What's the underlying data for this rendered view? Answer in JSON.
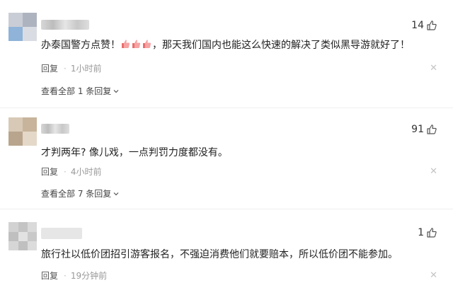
{
  "comments": [
    {
      "like_count": "14",
      "text_before": "办泰国警方点赞！",
      "emoji": [
        "thumbs-up-emoji",
        "thumbs-up-emoji",
        "thumbs-up-emoji"
      ],
      "text_after": "，那天我们国内也能这么快速的解决了类似黑导游就好了！",
      "reply_label": "回复",
      "time": "1小时前",
      "view_all": "查看全部 1 条回复"
    },
    {
      "like_count": "91",
      "text": "才判两年? 像儿戏，一点判罚力度都没有。",
      "reply_label": "回复",
      "time": "4小时前",
      "view_all": "查看全部 7 条回复"
    },
    {
      "like_count": "1",
      "text": "旅行社以低价团招引游客报名，不强迫消费他们就要赔本，所以低价团不能参加。",
      "reply_label": "回复",
      "time": "19分钟前"
    }
  ],
  "icons": {
    "like": "thumb-up-outline-icon",
    "dismiss": "close-icon",
    "expand": "chevron-down-icon"
  },
  "colors": {
    "text": "#222222",
    "meta": "#999999",
    "divider": "#efefef",
    "emoji": "#f08a8a"
  }
}
